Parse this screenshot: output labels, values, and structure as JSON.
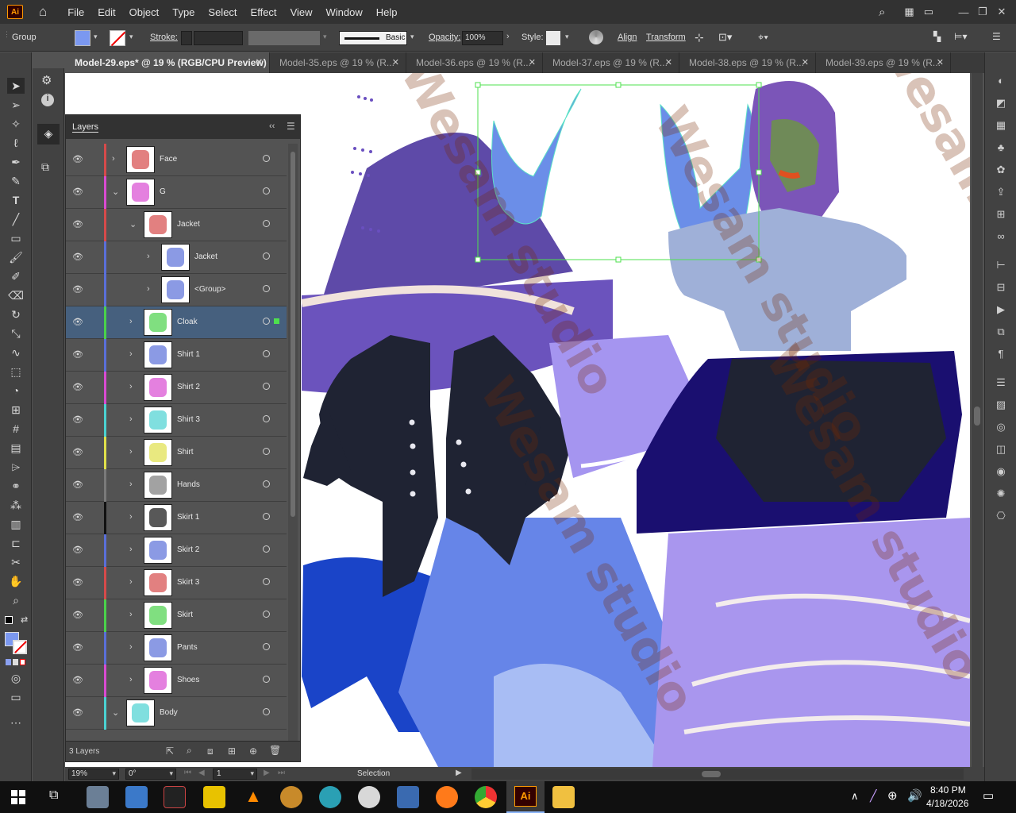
{
  "app": {
    "logo": "Ai",
    "color_accent": "#ff9a00"
  },
  "menu": [
    "File",
    "Edit",
    "Object",
    "Type",
    "Select",
    "Effect",
    "View",
    "Window",
    "Help"
  ],
  "control": {
    "selection_type": "Group",
    "stroke_label": "Stroke:",
    "brush_label": "Basic",
    "opacity_label": "Opacity:",
    "opacity_value": "100%",
    "style_label": "Style:",
    "align_label": "Align",
    "transform_label": "Transform",
    "fill_color": "#7b98f0"
  },
  "tabs": [
    {
      "label": "Model-29.eps* @ 19 % (RGB/CPU Preview)",
      "active": true
    },
    {
      "label": "Model-35.eps @ 19 % (R...",
      "active": false
    },
    {
      "label": "Model-36.eps @ 19 % (R...",
      "active": false
    },
    {
      "label": "Model-37.eps @ 19 % (R...",
      "active": false
    },
    {
      "label": "Model-38.eps @ 19 % (R...",
      "active": false
    },
    {
      "label": "Model-39.eps @ 19 % (R...",
      "active": false
    }
  ],
  "layers_panel": {
    "title": "Layers",
    "footer_count": "3 Layers",
    "rows": [
      {
        "name": "Face",
        "color": "#d64a4a",
        "indent": 0,
        "expanded": false
      },
      {
        "name": "G",
        "color": "#d94ad2",
        "indent": 0,
        "expanded": true
      },
      {
        "name": "Jacket",
        "color": "#d64a4a",
        "indent": 1,
        "expanded": true
      },
      {
        "name": "Jacket",
        "color": "#5a6fd8",
        "indent": 2,
        "expanded": false
      },
      {
        "name": "<Group>",
        "color": "#5a6fd8",
        "indent": 2,
        "expanded": false
      },
      {
        "name": "Cloak",
        "color": "#4ad24a",
        "indent": 1,
        "expanded": false,
        "selected": true
      },
      {
        "name": "Shirt 1",
        "color": "#5a6fd8",
        "indent": 1,
        "expanded": false
      },
      {
        "name": "Shirt 2",
        "color": "#d94ad2",
        "indent": 1,
        "expanded": false
      },
      {
        "name": "Shirt 3",
        "color": "#4ad2d2",
        "indent": 1,
        "expanded": false
      },
      {
        "name": "Shirt",
        "color": "#e0e04a",
        "indent": 1,
        "expanded": false
      },
      {
        "name": "Hands",
        "color": "#7a7a7a",
        "indent": 1,
        "expanded": false
      },
      {
        "name": "Skirt 1",
        "color": "#111111",
        "indent": 1,
        "expanded": false
      },
      {
        "name": "Skirt 2",
        "color": "#5a6fd8",
        "indent": 1,
        "expanded": false
      },
      {
        "name": "Skirt 3",
        "color": "#d64a4a",
        "indent": 1,
        "expanded": false
      },
      {
        "name": "Skirt",
        "color": "#4ad24a",
        "indent": 1,
        "expanded": false
      },
      {
        "name": "Pants",
        "color": "#5a6fd8",
        "indent": 1,
        "expanded": false
      },
      {
        "name": "Shoes",
        "color": "#d94ad2",
        "indent": 1,
        "expanded": false
      },
      {
        "name": "Body",
        "color": "#4ad2d2",
        "indent": 0,
        "expanded": true
      }
    ]
  },
  "status": {
    "zoom": "19%",
    "rotation": "0°",
    "artboard": "1",
    "tool": "Selection"
  },
  "watermark": "Wesam studio",
  "taskbar": {
    "time": "8:40 PM",
    "date": "4/18/2026"
  }
}
